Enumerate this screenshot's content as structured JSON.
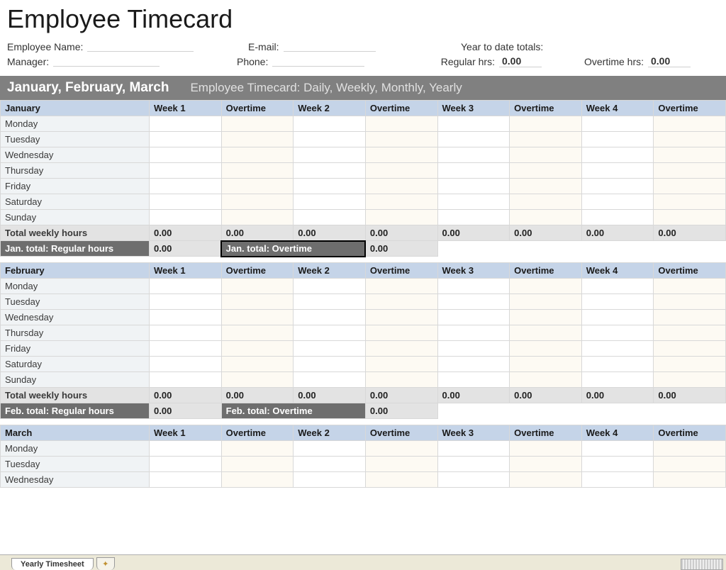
{
  "title": "Employee Timecard",
  "info": {
    "employee_name_label": "Employee Name:",
    "email_label": "E-mail:",
    "ytd_label": "Year to date totals:",
    "manager_label": "Manager:",
    "phone_label": "Phone:",
    "regular_hrs_label": "Regular hrs:",
    "regular_hrs_value": "0.00",
    "overtime_hrs_label": "Overtime hrs:",
    "overtime_hrs_value": "0.00"
  },
  "quarter": {
    "title": "January, February, March",
    "subtitle": "Employee Timecard: Daily, Weekly, Monthly, Yearly"
  },
  "columns": [
    "Week 1",
    "Overtime",
    "Week 2",
    "Overtime",
    "Week 3",
    "Overtime",
    "Week 4",
    "Overtime"
  ],
  "days": [
    "Monday",
    "Tuesday",
    "Wednesday",
    "Thursday",
    "Friday",
    "Saturday",
    "Sunday"
  ],
  "total_row_label": "Total weekly hours",
  "total_values": [
    "0.00",
    "0.00",
    "0.00",
    "0.00",
    "0.00",
    "0.00",
    "0.00",
    "0.00"
  ],
  "months": {
    "january": {
      "name": "January",
      "reg_total_label": "Jan. total: Regular hours",
      "reg_total_value": "0.00",
      "ot_total_label": "Jan. total: Overtime",
      "ot_total_value": "0.00"
    },
    "february": {
      "name": "February",
      "reg_total_label": "Feb. total: Regular hours",
      "reg_total_value": "0.00",
      "ot_total_label": "Feb.  total: Overtime",
      "ot_total_value": "0.00"
    },
    "march": {
      "name": "March",
      "visible_days": [
        "Monday",
        "Tuesday",
        "Wednesday"
      ]
    }
  },
  "sheet_tab": "Yearly Timesheet"
}
